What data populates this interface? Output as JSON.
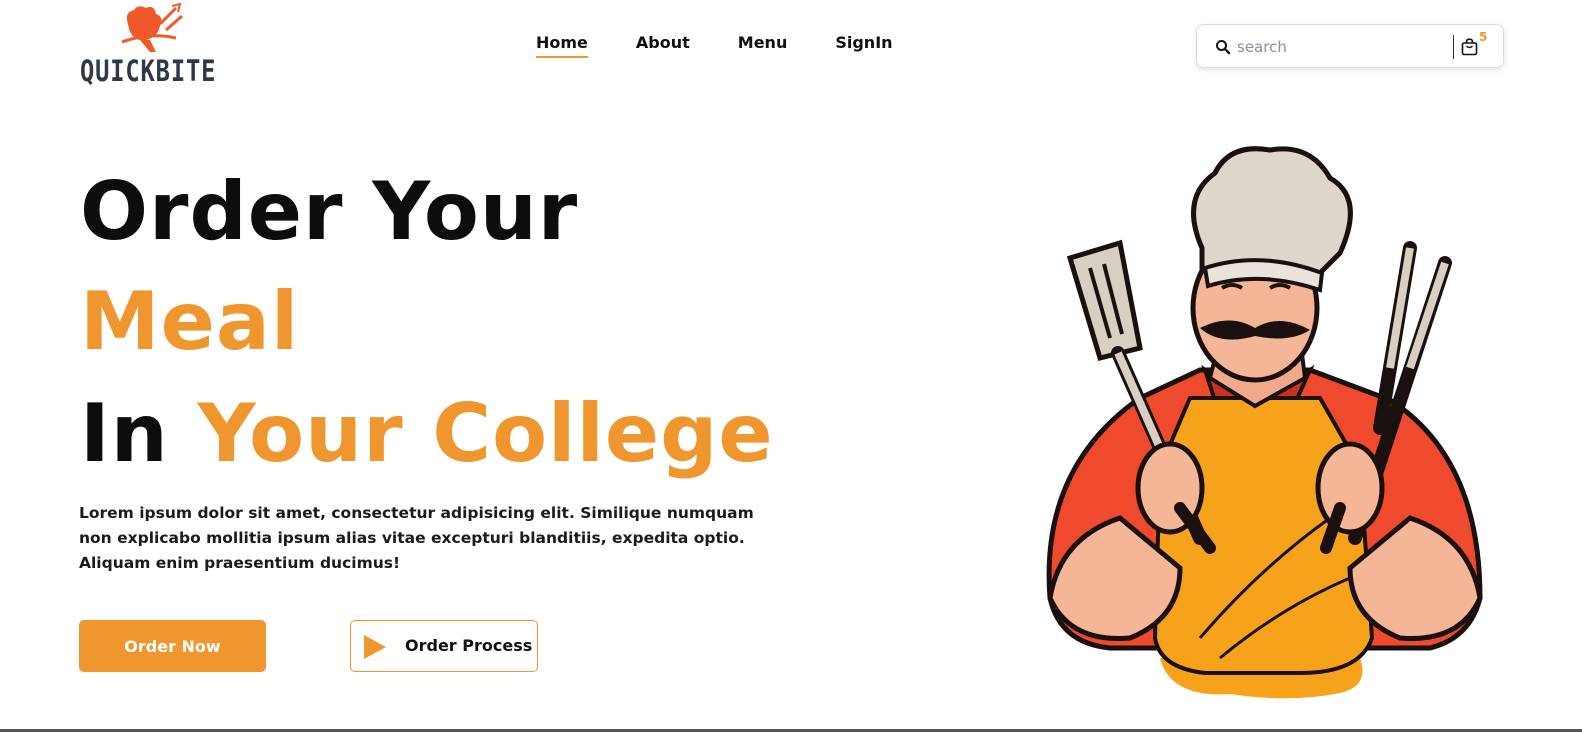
{
  "brand": {
    "name": "QUICKBITE",
    "logo_icon": "chef-hat-spoon-logo-icon"
  },
  "nav": {
    "items": [
      {
        "label": "Home",
        "active": true
      },
      {
        "label": "About",
        "active": false
      },
      {
        "label": "Menu",
        "active": false
      },
      {
        "label": "SignIn",
        "active": false
      }
    ]
  },
  "search": {
    "placeholder": "search",
    "value": "",
    "icon": "search-icon"
  },
  "cart": {
    "icon": "shopping-bag-icon",
    "count": "5"
  },
  "hero": {
    "line1": "Order Your",
    "line2": "Meal",
    "line3_prefix": "In ",
    "line3_accent": "Your College",
    "description": "Lorem ipsum dolor sit amet, consectetur adipisicing elit. Similique numquam non explicabo mollitia ipsum alias vitae excepturi blanditiis, expedita optio. Aliquam enim praesentium ducimus!",
    "order_button": "Order Now",
    "process_button": "Order Process",
    "process_icon": "play-icon",
    "illustration": "chef-illustration"
  },
  "colors": {
    "accent": "#f0962e",
    "text_dark": "#0d0d0d",
    "logo_text": "#2f3848",
    "chef_shirt": "#f04a2e",
    "chef_apron": "#f7a21b"
  }
}
